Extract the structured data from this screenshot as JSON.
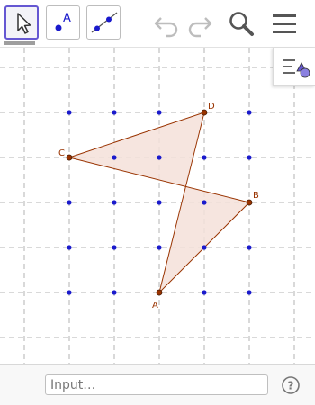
{
  "toolbar": {
    "tools": [
      {
        "name": "move-tool",
        "selected": true
      },
      {
        "name": "point-tool",
        "icon_letter": "A"
      },
      {
        "name": "line-tool"
      }
    ],
    "actions": [
      "undo",
      "redo",
      "search",
      "menu"
    ]
  },
  "graphics": {
    "grid_points": [
      [
        1,
        1
      ],
      [
        2,
        1
      ],
      [
        3,
        1
      ],
      [
        4,
        1
      ],
      [
        5,
        1
      ],
      [
        1,
        2
      ],
      [
        2,
        2
      ],
      [
        3,
        2
      ],
      [
        4,
        2
      ],
      [
        5,
        2
      ],
      [
        1,
        3
      ],
      [
        2,
        3
      ],
      [
        3,
        3
      ],
      [
        4,
        3
      ],
      [
        5,
        3
      ],
      [
        1,
        4
      ],
      [
        2,
        4
      ],
      [
        3,
        4
      ],
      [
        4,
        4
      ],
      [
        5,
        4
      ],
      [
        1,
        5
      ],
      [
        2,
        5
      ],
      [
        3,
        5
      ],
      [
        4,
        5
      ],
      [
        5,
        5
      ]
    ],
    "named_points": [
      {
        "label": "A",
        "x": 3,
        "y": 5
      },
      {
        "label": "B",
        "x": 5,
        "y": 3
      },
      {
        "label": "C",
        "x": 1,
        "y": 2
      },
      {
        "label": "D",
        "x": 4,
        "y": 1
      }
    ],
    "polygon_order": [
      "C",
      "D",
      "A",
      "B"
    ],
    "colors": {
      "grid": "#9a9a9a",
      "grid_point": "#1a1acc",
      "polygon_stroke": "#993300",
      "polygon_fill": "#f5e1d9",
      "point_fill": "#993300"
    }
  },
  "input_bar": {
    "placeholder": "Input…",
    "help_symbol": "?"
  }
}
